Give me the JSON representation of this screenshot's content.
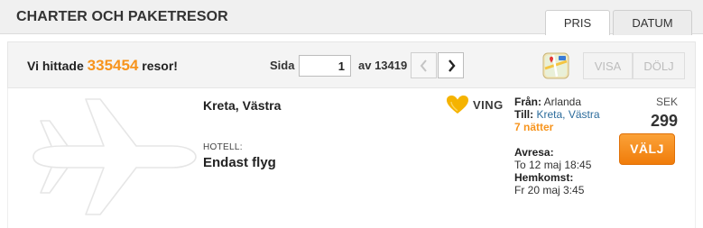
{
  "header": {
    "title": "CHARTER OCH PAKETRESOR",
    "tabs": [
      {
        "label": "PRIS",
        "active": true
      },
      {
        "label": "DATUM",
        "active": false
      }
    ]
  },
  "results_bar": {
    "found_prefix": "Vi hittade",
    "found_count": "335454",
    "found_suffix": "resor!",
    "page_label": "Sida",
    "page_value": "1",
    "page_total": "av 13419",
    "prev_icon": "chevron-left-icon",
    "next_icon": "chevron-right-icon",
    "map_icon": "map-icon",
    "show_label": "VISA",
    "hide_label": "DÖLJ"
  },
  "result": {
    "destination": "Kreta, Västra",
    "hotel_label": "HOTELL:",
    "hotel_name": "Endast flyg",
    "operator": "VING",
    "from_label": "Från:",
    "from_value": "Arlanda",
    "to_label": "Till:",
    "to_value": "Kreta, Västra",
    "nights": "7 nätter",
    "depart_label": "Avresa:",
    "depart_value": "To 12 maj 18:45",
    "return_label": "Hemkomst:",
    "return_value": "Fr 20 maj 3:45",
    "currency": "SEK",
    "price": "299",
    "select_label": "VÄLJ"
  },
  "colors": {
    "accent": "#f7941d",
    "link": "#2b6b9b",
    "button_start": "#fba238",
    "button_end": "#f07c0a"
  }
}
